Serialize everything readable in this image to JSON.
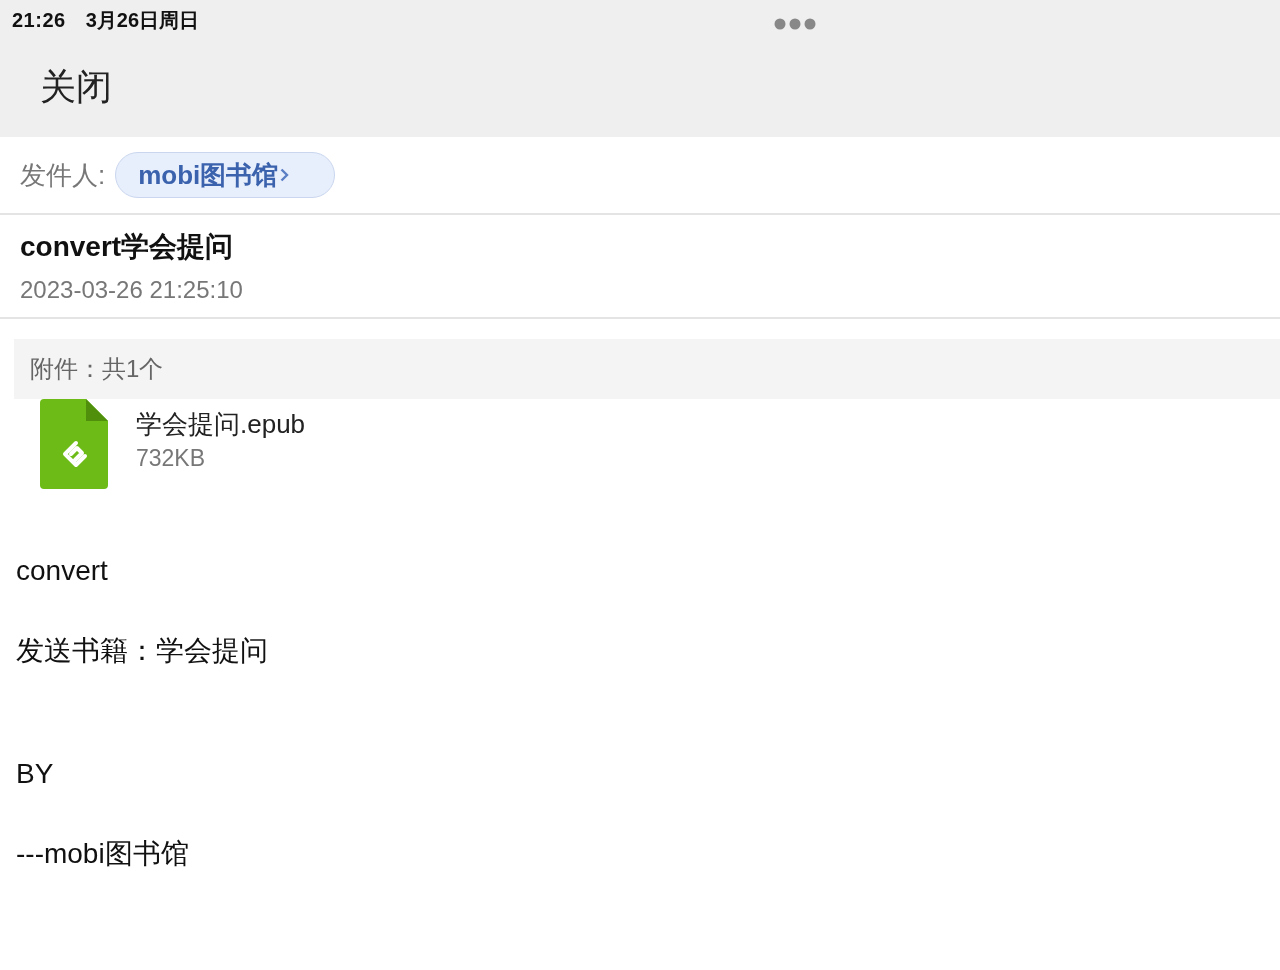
{
  "status_bar": {
    "time": "21:26",
    "date": "3月26日周日"
  },
  "header": {
    "close_button": "关闭"
  },
  "sender": {
    "label": "发件人:",
    "name": "mobi图书馆"
  },
  "subject": "convert学会提问",
  "date": "2023-03-26 21:25:10",
  "attachments": {
    "header": "附件：共1个",
    "files": [
      {
        "kind": "epub",
        "name": "学会提问.epub",
        "size": "732KB"
      }
    ]
  },
  "body": {
    "paragraphs": [
      [
        "convert",
        "发送书籍：学会提问"
      ],
      [
        "BY",
        "---mobi图书馆"
      ]
    ]
  }
}
